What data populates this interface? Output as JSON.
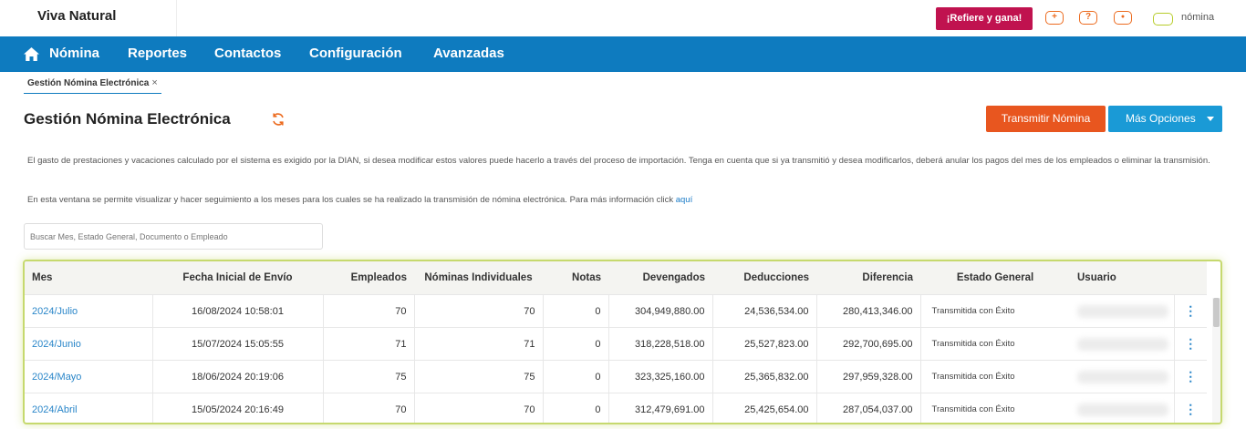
{
  "app": {
    "name": "Viva Natural",
    "refer_label": "¡Refiere y gana!",
    "product_label": "nómina"
  },
  "topbar_icons": [
    {
      "name": "plus-icon",
      "glyph": "+"
    },
    {
      "name": "help-icon",
      "glyph": "?"
    },
    {
      "name": "user-icon",
      "glyph": "●"
    }
  ],
  "nav": [
    "Nómina",
    "Reportes",
    "Contactos",
    "Configuración",
    "Avanzadas"
  ],
  "tab": {
    "label": "Gestión Nómina Electrónica",
    "close": "×"
  },
  "page": {
    "title": "Gestión Nómina Electrónica",
    "transmit_label": "Transmitir Nómina",
    "more_label": "Más Opciones",
    "info1": "El gasto de prestaciones y vacaciones calculado por el sistema es exigido por la DIAN, si desea modificar estos valores puede hacerlo a través del proceso de importación. Tenga en cuenta que si ya transmitió y desea modificarlos, deberá anular los pagos del mes de los empleados o eliminar la transmisión.",
    "info2": "En esta ventana se permite visualizar y hacer seguimiento a los meses para los cuales se ha realizado la transmisión de nómina electrónica. Para más información click ",
    "info2_link": "aquí",
    "search_placeholder": "Buscar Mes, Estado General, Documento o Empleado"
  },
  "table": {
    "headers": {
      "mes": "Mes",
      "fecha": "Fecha Inicial de Envío",
      "empleados": "Empleados",
      "nominas": "Nóminas Individuales",
      "notas": "Notas",
      "devengados": "Devengados",
      "deducciones": "Deducciones",
      "diferencia": "Diferencia",
      "estado": "Estado General",
      "usuario": "Usuario"
    },
    "rows": [
      {
        "mes": "2024/Julio",
        "fecha": "16/08/2024 10:58:01",
        "empleados": "70",
        "nominas": "70",
        "notas": "0",
        "devengados": "304,949,880.00",
        "deducciones": "24,536,534.00",
        "diferencia": "280,413,346.00",
        "estado": "Transmitida con Éxito"
      },
      {
        "mes": "2024/Junio",
        "fecha": "15/07/2024 15:05:55",
        "empleados": "71",
        "nominas": "71",
        "notas": "0",
        "devengados": "318,228,518.00",
        "deducciones": "25,527,823.00",
        "diferencia": "292,700,695.00",
        "estado": "Transmitida con Éxito"
      },
      {
        "mes": "2024/Mayo",
        "fecha": "18/06/2024 20:19:06",
        "empleados": "75",
        "nominas": "75",
        "notas": "0",
        "devengados": "323,325,160.00",
        "deducciones": "25,365,832.00",
        "diferencia": "297,959,328.00",
        "estado": "Transmitida con Éxito"
      },
      {
        "mes": "2024/Abril",
        "fecha": "15/05/2024 20:16:49",
        "empleados": "70",
        "nominas": "70",
        "notas": "0",
        "devengados": "312,479,691.00",
        "deducciones": "25,425,654.00",
        "diferencia": "287,054,037.00",
        "estado": "Transmitida con Éxito"
      }
    ]
  },
  "colors": {
    "nav_bg": "#0e7bbf",
    "refer_bg": "#c0124f",
    "transmit_bg": "#e8561f",
    "more_bg": "#1a9ad6",
    "accent_orange": "#ec6b1f",
    "table_border": "#c6d96e"
  }
}
